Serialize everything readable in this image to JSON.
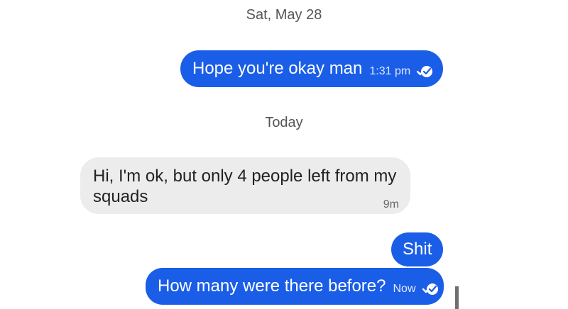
{
  "conversation": {
    "date_separators": [
      "Sat, May 28",
      "Today"
    ],
    "messages": [
      {
        "direction": "outgoing",
        "text": "Hope you're okay man",
        "time": "1:31 pm",
        "status": "read"
      },
      {
        "direction": "incoming",
        "text_line1": "Hi, I'm ok, but only 4 people  left from my",
        "text_line2": "squads",
        "time": "9m"
      },
      {
        "direction": "outgoing",
        "text": "Shit"
      },
      {
        "direction": "outgoing",
        "text": "How many were there before?",
        "time": "Now",
        "status": "read"
      }
    ]
  },
  "colors": {
    "outgoing_bubble": "#1a5ee8",
    "incoming_bubble": "#ececec",
    "separator_text": "#555555"
  },
  "icons": {
    "read_receipt": "read-check-icon"
  }
}
